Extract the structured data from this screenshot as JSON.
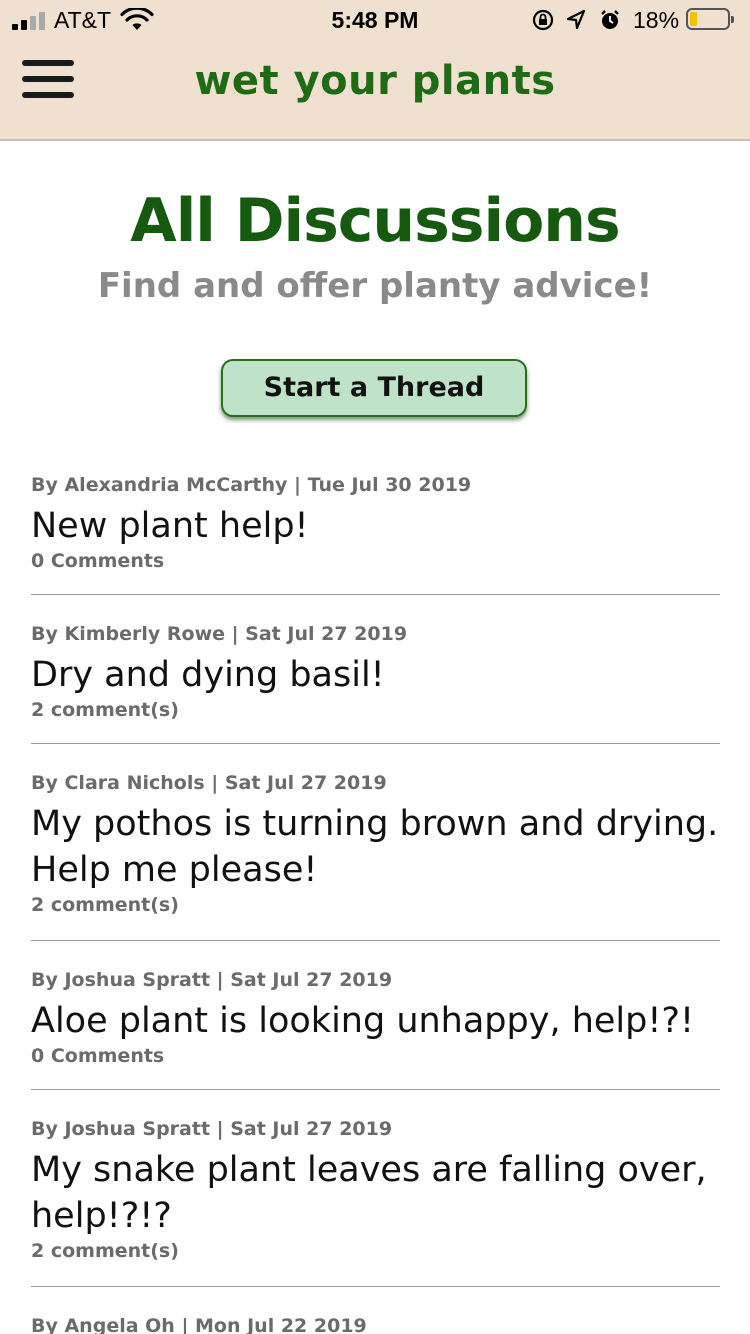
{
  "status_bar": {
    "carrier": "AT&T",
    "time": "5:48 PM",
    "battery_percent": "18%",
    "battery_level": 0.18,
    "icons": [
      "signal-icon",
      "wifi-icon",
      "orientation-lock-icon",
      "location-icon",
      "alarm-icon",
      "battery-icon"
    ]
  },
  "header": {
    "brand": "wet your plants",
    "menu_icon": "hamburger-menu-icon",
    "background": "#f0e0cf",
    "brand_color": "#1f6a14"
  },
  "page": {
    "title": "All Discussions",
    "subtitle": "Find and offer planty advice!",
    "start_button": "Start a Thread",
    "button_color": "#bfe3c8"
  },
  "threads": [
    {
      "meta": "By Alexandria McCarthy | Tue Jul 30 2019",
      "title": "New plant help!",
      "comments": "0 Comments"
    },
    {
      "meta": "By Kimberly Rowe | Sat Jul 27 2019",
      "title": "Dry and dying basil!",
      "comments": "2 comment(s)"
    },
    {
      "meta": "By Clara Nichols | Sat Jul 27 2019",
      "title": "My pothos is turning brown and drying. Help me please!",
      "comments": "2 comment(s)"
    },
    {
      "meta": "By Joshua Spratt | Sat Jul 27 2019",
      "title": "Aloe plant is looking unhappy, help!?!",
      "comments": "0 Comments"
    },
    {
      "meta": "By Joshua Spratt | Sat Jul 27 2019",
      "title": "My snake plant leaves are falling over, help!?!?",
      "comments": "2 comment(s)"
    },
    {
      "meta": "By Angela Oh | Mon Jul 22 2019"
    }
  ]
}
